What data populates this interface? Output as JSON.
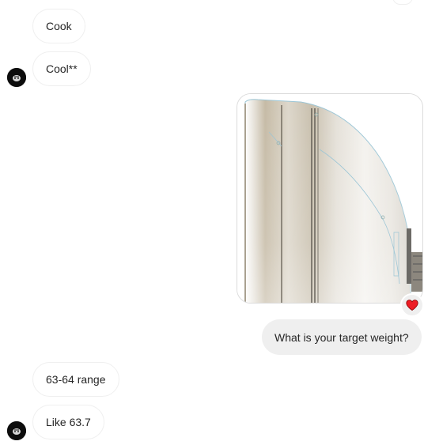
{
  "messages": [
    {
      "sender": "them",
      "text": "Cook"
    },
    {
      "sender": "them",
      "text": "Cool**"
    },
    {
      "sender": "me",
      "type": "photo",
      "reaction": "heart"
    },
    {
      "sender": "me",
      "text": "What is your target weight?"
    },
    {
      "sender": "them",
      "text": "63-64 range"
    },
    {
      "sender": "them",
      "text": "Like 63.7"
    }
  ],
  "colors": {
    "incoming_border": "#efefef",
    "outgoing_bg": "#efefef",
    "reaction_heart": "#ed1c24",
    "avatar_bg": "#0d0d0d"
  },
  "icons": {
    "avatar": "avatar-icon",
    "reaction": "heart-icon"
  }
}
